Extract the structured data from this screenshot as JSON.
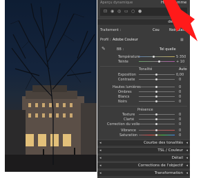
{
  "panel": {
    "top_label": "Aperçu dynamique",
    "histogram_title": "Histogramme",
    "basic_title": "de base",
    "treatment_label": "Traitement :",
    "treatment_options": [
      "Cou",
      "Noir/blanc"
    ],
    "profile_label": "Profil :",
    "profile_value": "Adobe Couleur",
    "wb_label": "BB :",
    "wb_value": "Tel quelle",
    "temperature_label": "Température",
    "temperature_value": "5 350",
    "tint_label": "Teinte",
    "tint_value": "+ 10",
    "tone_label": "Tonalité",
    "tone_auto": "Auto",
    "exposure_label": "Exposition",
    "exposure_value": "0,00",
    "contrast_label": "Contraste",
    "contrast_value": "0",
    "highlights_label": "Hautes lumières",
    "highlights_value": "0",
    "shadows_label": "Ombres",
    "shadows_value": "0",
    "whites_label": "Blancs",
    "whites_value": "0",
    "blacks_label": "Noirs",
    "blacks_value": "0",
    "presence_label": "Présence",
    "texture_label": "Texture",
    "texture_value": "0",
    "clarity_label": "Clarté",
    "clarity_value": "0",
    "dehaze_label": "Correction du voile",
    "dehaze_value": "0",
    "vibrance_label": "Vibrance",
    "vibrance_value": "0",
    "saturation_label": "Saturation",
    "saturation_value": "0",
    "sections": [
      {
        "label": "Courbe des tonalités"
      },
      {
        "label": "TSL / Couleur"
      },
      {
        "label": "Détail"
      },
      {
        "label": "Corrections de l'objectif"
      },
      {
        "label": "Transformation"
      }
    ]
  },
  "colors": {
    "panel_bg": "#3b3b3b",
    "header_bg": "#2e2e2e",
    "arrow": "#ff1a1a"
  }
}
